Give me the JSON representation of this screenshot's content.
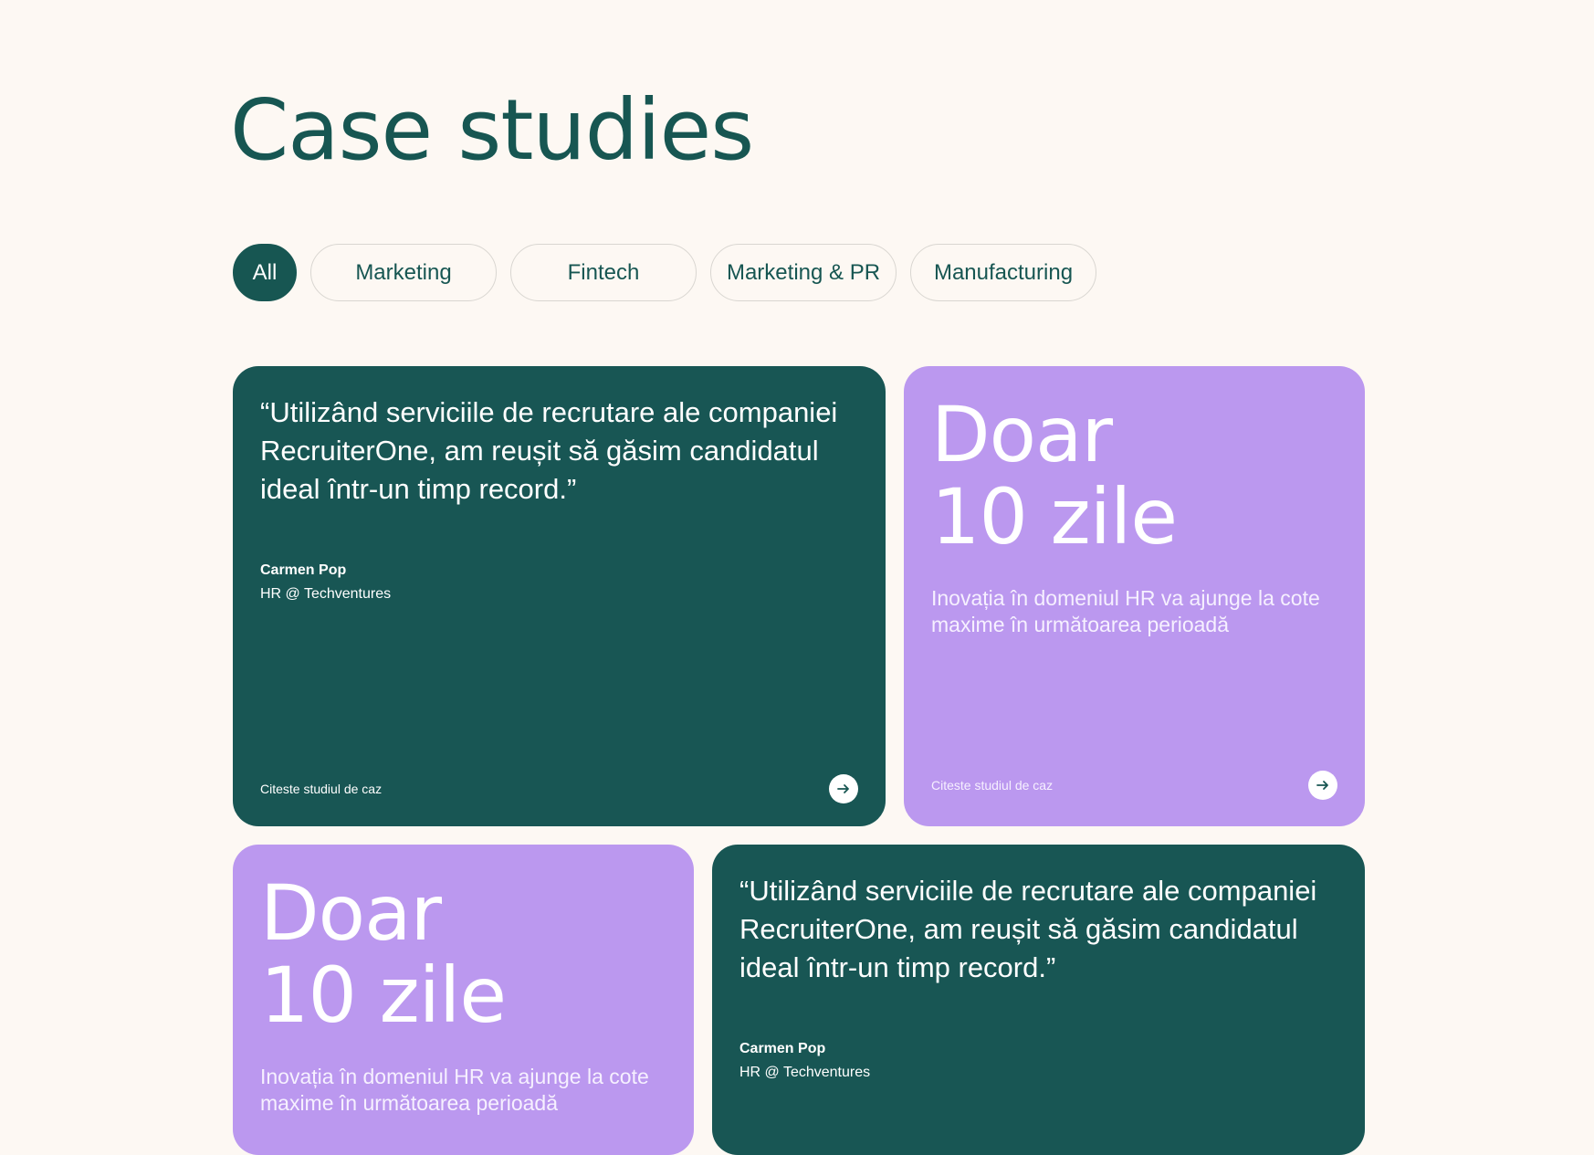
{
  "page": {
    "title": "Case studies"
  },
  "filters": [
    {
      "label": "All",
      "active": true
    },
    {
      "label": "Marketing",
      "active": false
    },
    {
      "label": "Fintech",
      "active": false
    },
    {
      "label": "Marketing & PR",
      "active": false
    },
    {
      "label": "Manufacturing",
      "active": false
    }
  ],
  "colors": {
    "background": "#fdf8f3",
    "brand_green": "#185654",
    "accent_purple": "#bb98ef",
    "chip_border": "#d9d6d1"
  },
  "cards": [
    {
      "type": "quote",
      "color": "green",
      "quote": "“Utilizând serviciile de recrutare ale companiei RecruiterOne, am reușit să găsim candidatul ideal într-un timp record.”",
      "author": "Carmen Pop",
      "role": "HR @ Techventures",
      "link_label": "Citeste studiul de caz",
      "link_icon": "arrow-right-icon"
    },
    {
      "type": "stat",
      "color": "purple",
      "stat_line1": "Doar",
      "stat_line2": "10 zile",
      "description": "Inovația în domeniul HR va ajunge la cote maxime în următoarea perioadă",
      "link_label": "Citeste studiul de caz",
      "link_icon": "arrow-right-icon"
    },
    {
      "type": "stat",
      "color": "purple",
      "stat_line1": "Doar",
      "stat_line2": "10 zile",
      "description": "Inovația în domeniul HR va ajunge la cote maxime în următoarea perioadă"
    },
    {
      "type": "quote",
      "color": "green",
      "quote": "“Utilizând serviciile de recrutare ale companiei RecruiterOne, am reușit să găsim candidatul ideal într-un timp record.”",
      "author": "Carmen Pop",
      "role": "HR @ Techventures"
    }
  ]
}
